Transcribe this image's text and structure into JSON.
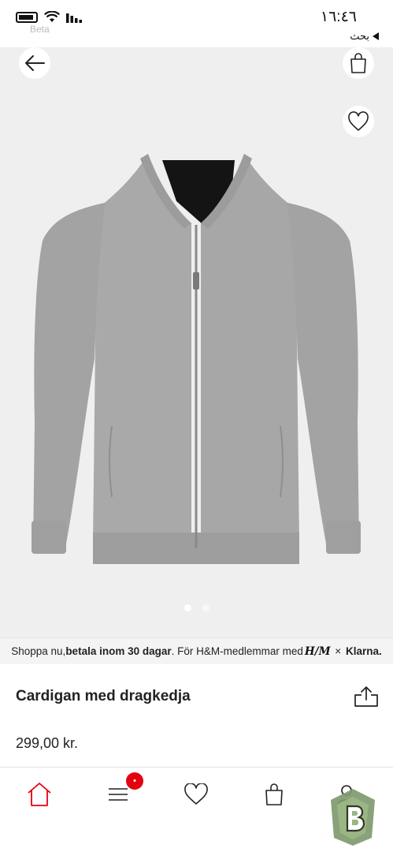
{
  "status_bar": {
    "carrier": "Beta",
    "time": "١٦:٤٦",
    "back_label": "بحث"
  },
  "hero": {
    "image_alt": "",
    "dots": [
      {
        "active": true
      },
      {
        "active": false
      }
    ]
  },
  "banner": {
    "prefix": "Shoppa nu, ",
    "bold": "betala inom 30 dagar",
    "middle": ". För H&M-medlemmar med ",
    "hm_logo": "H/M",
    "times": "×",
    "klarna": "Klarna."
  },
  "product": {
    "name": "Cardigan med dragkedja",
    "price": "299,00 kr."
  },
  "bottom_nav": {
    "items": [
      {
        "icon": "home-icon"
      },
      {
        "icon": "menu-icon"
      },
      {
        "icon": "heart-icon"
      },
      {
        "icon": "bag-icon"
      },
      {
        "icon": "account-icon"
      }
    ],
    "menu_badge": "•"
  },
  "colors": {
    "accent": "#e50010",
    "hero_bg": "#efefef",
    "jacket": "#a9a9a9"
  }
}
